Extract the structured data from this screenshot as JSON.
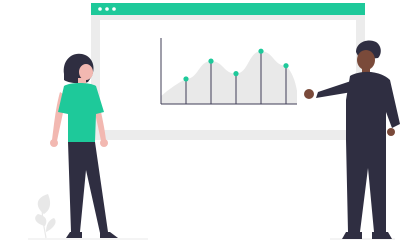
{
  "illustration": {
    "browser_window": {
      "titlebar_dots": [
        "window-dot",
        "window-dot",
        "window-dot"
      ]
    },
    "chart": {
      "series_relative_levels": [
        0.38,
        0.65,
        0.46,
        0.8,
        0.58
      ]
    },
    "people": [
      {
        "role": "woman-standing"
      },
      {
        "role": "man-presenting"
      }
    ],
    "plant": "leaf-plant"
  },
  "colors": {
    "accent": "#1ec99a",
    "frame": "#ececec",
    "screen": "#ffffff",
    "chart_fill": "#e9e9e9",
    "axis": "#3f3d56",
    "dark_clothes": "#2f2e41",
    "skin_light": "#f2b8b1",
    "skin_dark": "#7a4a3a",
    "hair_dark": "#2f2e41",
    "floor": "#ededed",
    "plant": "#e8e8e8"
  }
}
